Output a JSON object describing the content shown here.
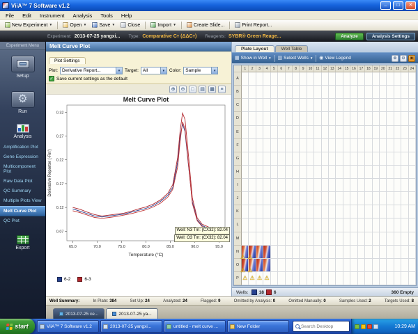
{
  "window": {
    "title": "ViiA™ 7 Software v1.2",
    "menu": [
      "File",
      "Edit",
      "Instrument",
      "Analysis",
      "Tools",
      "Help"
    ],
    "toolbar": [
      {
        "name": "new-experiment-button",
        "label": "New Experiment",
        "icon": "new-experiment-icon",
        "icon_color": "#8fbe4e",
        "arrow": true,
        "sep_after": true
      },
      {
        "name": "open-button",
        "label": "Open",
        "icon": "open-folder-icon",
        "icon_color": "#edc25a",
        "arrow": true,
        "sep_after": false
      },
      {
        "name": "save-button",
        "label": "Save",
        "icon": "save-icon",
        "icon_color": "#4a77c4",
        "arrow": true,
        "sep_after": false
      },
      {
        "name": "close-button",
        "label": "Close",
        "icon": "close-doc-icon",
        "icon_color": "#b8c0cc",
        "arrow": false,
        "sep_after": true
      },
      {
        "name": "import-button",
        "label": "Import",
        "icon": "import-icon",
        "icon_color": "#57a857",
        "arrow": true,
        "sep_after": true
      },
      {
        "name": "create-slide-button",
        "label": "Create Slide...",
        "icon": "create-slide-icon",
        "icon_color": "#e09040",
        "arrow": false,
        "sep_after": true
      },
      {
        "name": "print-report-button",
        "label": "Print Report...",
        "icon": "print-icon",
        "icon_color": "#9aa6b4",
        "arrow": false,
        "sep_after": false
      }
    ]
  },
  "experiment_bar": {
    "experiment_label": "Experiment:",
    "experiment_value": "2013-07-25 yangxi...",
    "type_label": "Type:",
    "type_value": "Comparative Cт (ΔΔCт)",
    "reagents_label": "Reagents:",
    "reagents_value": "SYBR® Green Reage...",
    "analyze_button": "Analyze",
    "analysis_settings_button": "Analysis Settings"
  },
  "sidebar": {
    "header": "Experiment Menu",
    "setup": "Setup",
    "run": "Run",
    "analysis": "Analysis",
    "export": "Export",
    "analysis_items": [
      {
        "label": "Amplification Plot",
        "active": false
      },
      {
        "label": "Gene Expression",
        "active": false
      },
      {
        "label": "Multicomponent Plot",
        "active": false
      },
      {
        "label": "Raw Data Plot",
        "active": false
      },
      {
        "label": "QC Summary",
        "active": false
      },
      {
        "label": "Multiple Plots View",
        "active": false
      },
      {
        "label": "Melt Curve Plot",
        "active": true
      },
      {
        "label": "QC Plot",
        "active": false
      }
    ]
  },
  "plot_panel": {
    "title": "Melt Curve Plot",
    "settings_tab": "Plot Settings",
    "plot_label": "Plot:",
    "plot_value": "Derivative Report...",
    "target_label": "Target:",
    "target_value": "All",
    "color_label": "Color:",
    "color_value": "Sample",
    "save_default": "Save current settings as the default",
    "tooltip1": "Well: N3  Tm: (CX32): 82.04",
    "tooltip2": "Well: O3  Tm: (CX32): 82.04",
    "legend": [
      {
        "label": "6-2",
        "color": "#27418f"
      },
      {
        "label": "6-3",
        "color": "#b2282e"
      }
    ],
    "chart_toolbar": [
      {
        "name": "zoom-in-icon",
        "glyph": "⊕"
      },
      {
        "name": "zoom-out-icon",
        "glyph": "⊖"
      },
      {
        "name": "zoom-reset-icon",
        "glyph": "□"
      },
      {
        "name": "select-data-icon",
        "glyph": "▤"
      },
      {
        "name": "chart-grid-icon",
        "glyph": "▦"
      },
      {
        "name": "chart-options-icon",
        "glyph": "≡"
      }
    ]
  },
  "chart_data": {
    "type": "line",
    "title": "Melt Curve Plot",
    "xlabel": "Temperature (°C)",
    "ylabel": "Derivative Reporter (-Rn')",
    "xlim": [
      63.8,
      96.2
    ],
    "ylim": [
      0.05,
      0.335
    ],
    "xticks": [
      65,
      70,
      75,
      80,
      85,
      90,
      95
    ],
    "yticks": [
      0.07,
      0.12,
      0.17,
      0.22,
      0.27,
      0.32
    ],
    "grid": false,
    "legend_position": "bottom-left",
    "x": [
      65,
      66.5,
      68,
      69.5,
      71,
      72.5,
      74,
      75.5,
      77,
      78.5,
      80,
      81.5,
      83,
      84.5,
      85.5,
      86.5,
      87,
      87.5,
      88,
      88.5,
      89.5,
      90.5,
      91.5,
      93,
      95
    ],
    "series": [
      {
        "name": "6-2",
        "color": "#27418f",
        "values": [
          0.117,
          0.112,
          0.107,
          0.102,
          0.1,
          0.102,
          0.104,
          0.106,
          0.11,
          0.114,
          0.118,
          0.124,
          0.133,
          0.146,
          0.162,
          0.215,
          0.268,
          0.295,
          0.28,
          0.228,
          0.132,
          0.094,
          0.082,
          0.075,
          0.07
        ]
      },
      {
        "name": "6-3 (well N3)",
        "color": "#b2282e",
        "values": [
          0.12,
          0.116,
          0.11,
          0.105,
          0.102,
          0.104,
          0.106,
          0.108,
          0.112,
          0.117,
          0.121,
          0.127,
          0.136,
          0.15,
          0.168,
          0.225,
          0.28,
          0.318,
          0.305,
          0.252,
          0.14,
          0.098,
          0.085,
          0.078,
          0.072
        ]
      },
      {
        "name": "6-3 (well O3)",
        "color": "#c23434",
        "values": [
          0.113,
          0.109,
          0.104,
          0.099,
          0.097,
          0.099,
          0.101,
          0.104,
          0.107,
          0.111,
          0.115,
          0.121,
          0.129,
          0.142,
          0.158,
          0.205,
          0.258,
          0.3,
          0.285,
          0.232,
          0.128,
          0.092,
          0.08,
          0.074,
          0.069
        ]
      }
    ]
  },
  "plate_panel": {
    "tabs": [
      {
        "label": "Plate Layout",
        "active": true
      },
      {
        "label": "Well Table",
        "active": false
      }
    ],
    "toolbar_items": [
      {
        "name": "show-in-well-menu",
        "label": "Show in Well",
        "glyph": "▦",
        "icon": "show-in-well-icon",
        "arrow": true
      },
      {
        "name": "select-wells-menu",
        "label": "Select Wells",
        "glyph": "▥",
        "icon": "select-wells-icon",
        "arrow": true
      },
      {
        "name": "view-legend-button",
        "label": "View Legend",
        "glyph": "◉",
        "icon": "view-legend-icon",
        "arrow": false
      }
    ],
    "toolbar_right_icons": [
      {
        "name": "plate-zoom-in-icon",
        "glyph": "⊕",
        "accent": false
      },
      {
        "name": "plate-zoom-out-icon",
        "glyph": "⊖",
        "accent": false
      },
      {
        "name": "plate-print-icon",
        "glyph": "▣",
        "accent": true
      }
    ],
    "columns": [
      "1",
      "2",
      "3",
      "4",
      "5",
      "6",
      "7",
      "8",
      "9",
      "10",
      "11",
      "12",
      "13",
      "14",
      "15",
      "16",
      "17",
      "18",
      "19",
      "20",
      "21",
      "22",
      "23",
      "24"
    ],
    "rows": [
      "A",
      "B",
      "C",
      "D",
      "E",
      "F",
      "G",
      "H",
      "I",
      "J",
      "K",
      "L",
      "M",
      "N",
      "O",
      "P"
    ],
    "wells": [
      {
        "id": "N1",
        "fill": "heat-a",
        "flag": true
      },
      {
        "id": "N2",
        "fill": "heat-b",
        "flag": true
      },
      {
        "id": "N3",
        "fill": "heat-a",
        "flag": false
      },
      {
        "id": "N4",
        "fill": "heat-b",
        "flag": false
      },
      {
        "id": "O1",
        "fill": "heat-b",
        "flag": true
      },
      {
        "id": "O2",
        "fill": "heat-a",
        "flag": true
      },
      {
        "id": "O3",
        "fill": "heat-b",
        "flag": false
      },
      {
        "id": "O4",
        "fill": "heat-a",
        "flag": false
      },
      {
        "id": "P1",
        "fill": "none",
        "flag": true
      },
      {
        "id": "P2",
        "fill": "none",
        "flag": true
      },
      {
        "id": "P3",
        "fill": "none",
        "flag": true
      },
      {
        "id": "P4",
        "fill": "none",
        "flag": true
      }
    ],
    "status": {
      "wells_label": "Wells:",
      "counts": [
        {
          "color": "#27418f",
          "value": "18"
        },
        {
          "color": "#b2282e",
          "value": "6"
        }
      ],
      "empty": "360 Empty"
    }
  },
  "well_summary": {
    "label": "Well Summary:",
    "stats": [
      {
        "label": "In Plate:",
        "value": "384"
      },
      {
        "label": "Set Up:",
        "value": "24"
      },
      {
        "label": "Analyzed:",
        "value": "24"
      },
      {
        "label": "Flagged:",
        "value": "9"
      },
      {
        "label": "Omitted by Analysis:",
        "value": "0"
      },
      {
        "label": "Omitted Manually:",
        "value": "0"
      },
      {
        "label": "Samples Used:",
        "value": "2"
      },
      {
        "label": "Targets Used:",
        "value": "8"
      }
    ]
  },
  "doc_tabs": [
    {
      "label": "2013-07-25 ce...",
      "style": "dark",
      "icon_color": "#62b1e8"
    },
    {
      "label": "2013-07-25 ya...",
      "style": "light",
      "icon_color": "#4a90d8"
    }
  ],
  "taskbar": {
    "start": "start",
    "items": [
      {
        "label": "ViiA™ 7 Software v1.2",
        "icon_color": "#bcd3ee"
      },
      {
        "label": "2013-07-25 yangxi...",
        "icon_color": "#cfe2f8"
      },
      {
        "label": "untitled - melt curve ...",
        "icon_color": "#8fd0a8"
      },
      {
        "label": "New Folder",
        "icon_color": "#f2cf6a"
      }
    ],
    "search_placeholder": "Search Desktop",
    "tray_icon_colors": [
      "#7ac143",
      "#f5c518",
      "#e84b35",
      "#cfe2f8"
    ],
    "time": "10:29 AM"
  }
}
